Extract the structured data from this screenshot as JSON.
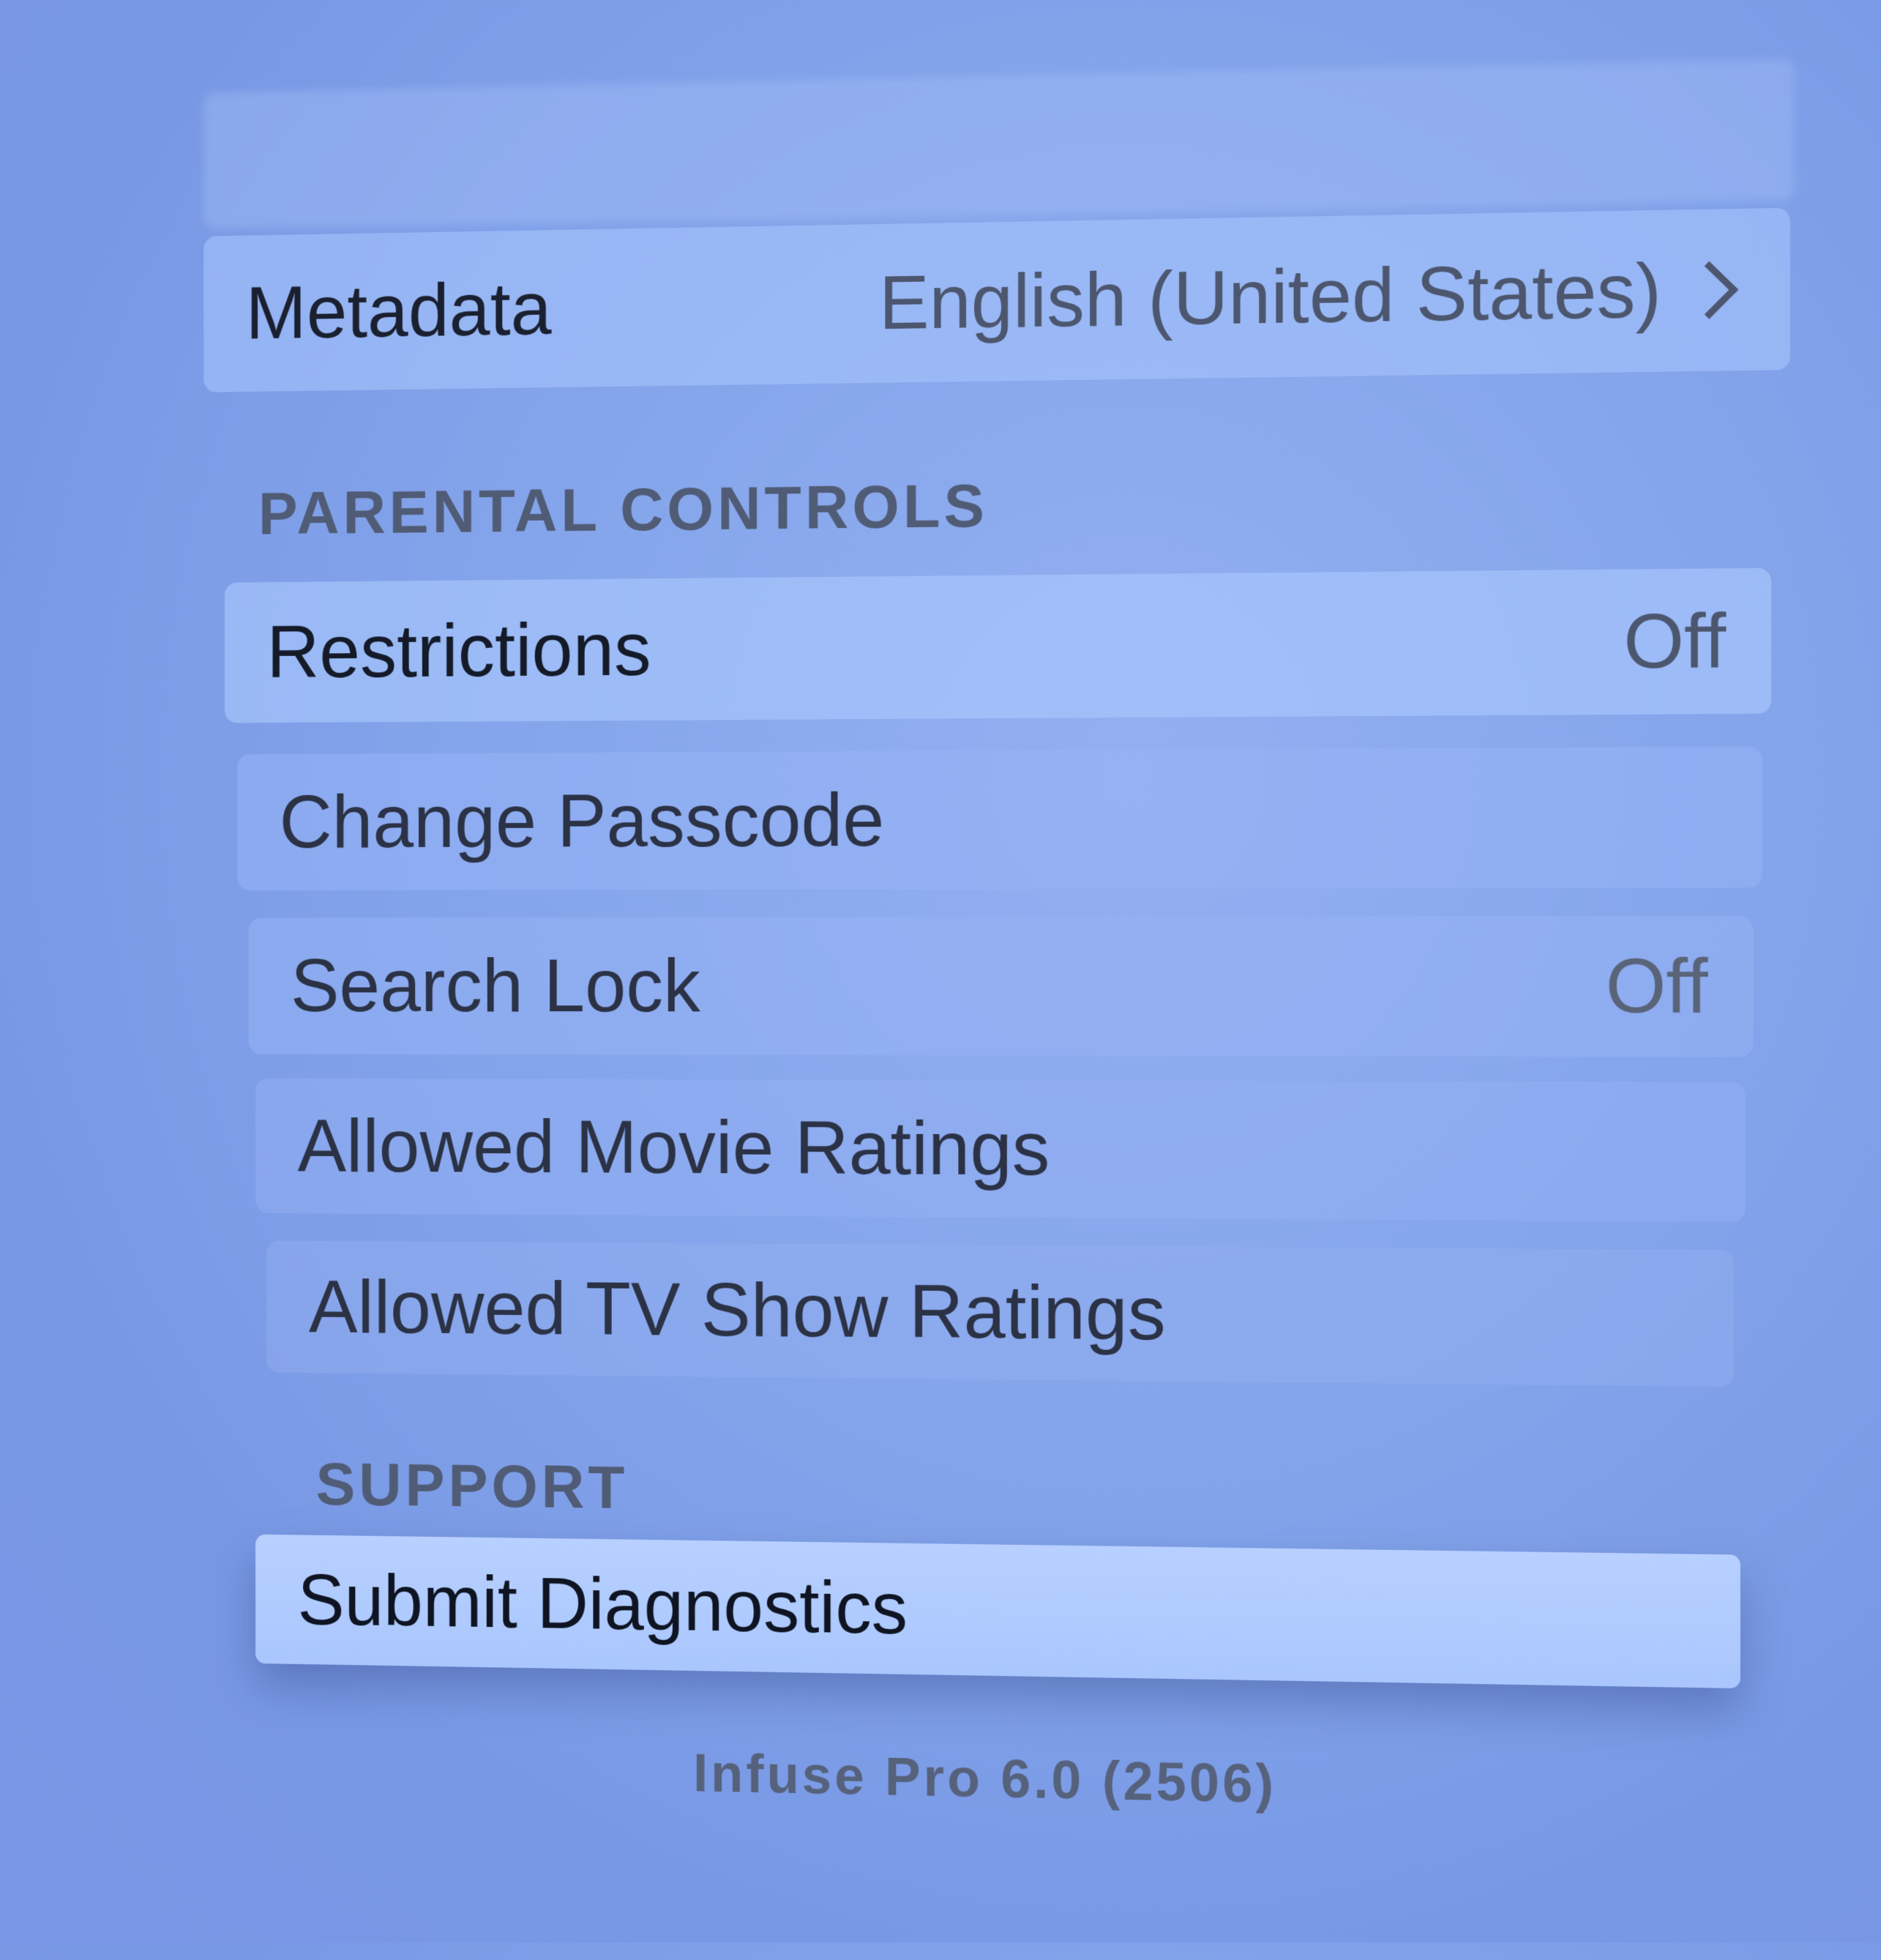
{
  "rows": {
    "metadata": {
      "label": "Metadata",
      "value": "English (United States)"
    },
    "restrictions": {
      "label": "Restrictions",
      "value": "Off"
    },
    "change_passcode": {
      "label": "Change Passcode"
    },
    "search_lock": {
      "label": "Search Lock",
      "value": "Off"
    },
    "allowed_movie_ratings": {
      "label": "Allowed Movie Ratings"
    },
    "allowed_tv_show_ratings": {
      "label": "Allowed TV Show Ratings"
    },
    "submit_diagnostics": {
      "label": "Submit Diagnostics"
    }
  },
  "sections": {
    "parental_controls": "PARENTAL CONTROLS",
    "support": "SUPPORT"
  },
  "footer": {
    "version": "Infuse Pro 6.0 (2506)"
  },
  "icons": {
    "metadata_disclosure": "chevron-right-icon"
  },
  "colors": {
    "background": "#82a3ea",
    "focused_row": "#b7d0ff",
    "text_primary": "#1b2030",
    "text_secondary": "#4c566e"
  }
}
